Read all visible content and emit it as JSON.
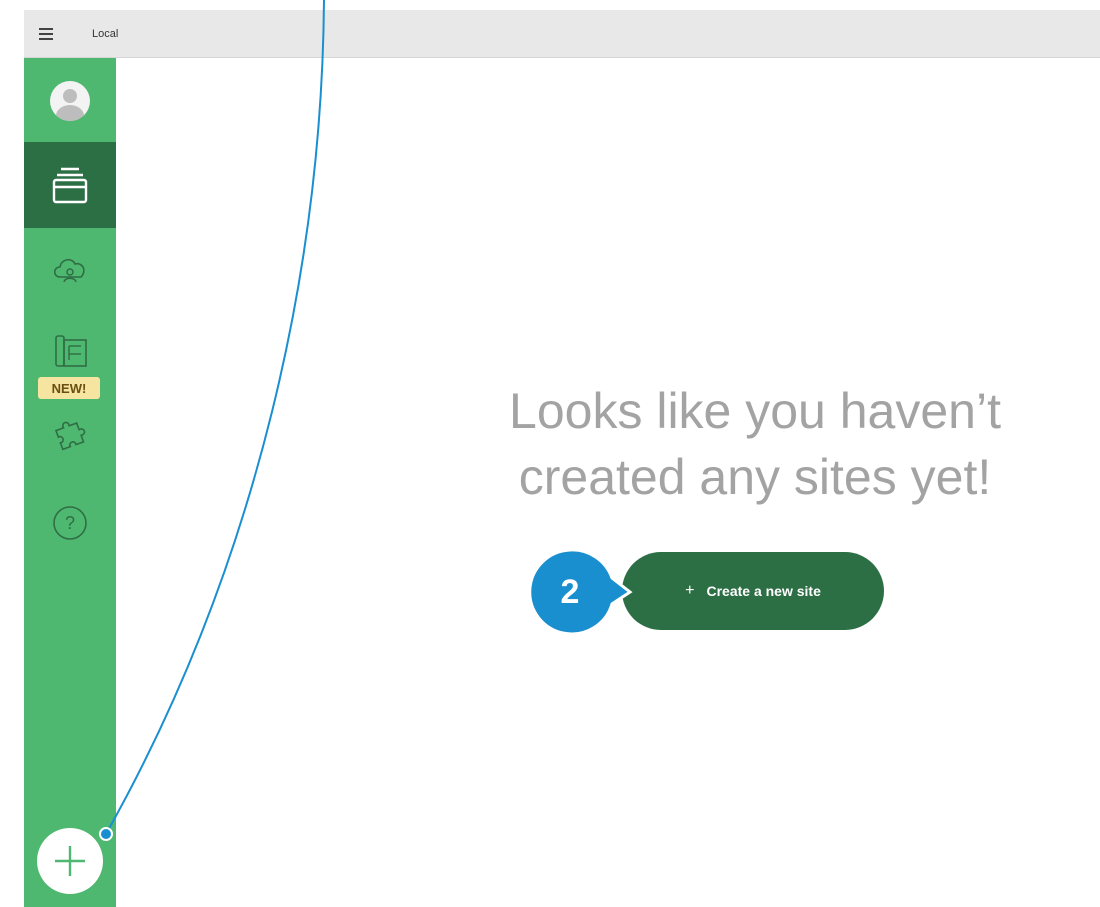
{
  "titlebar": {
    "menu_icon": "hamburger-icon",
    "title": "Local"
  },
  "sidebar": {
    "items": [
      {
        "name": "avatar",
        "icon": "user-avatar-icon"
      },
      {
        "name": "local-sites",
        "icon": "sites-stack-icon",
        "active": true
      },
      {
        "name": "connect",
        "icon": "cloud-connect-icon"
      },
      {
        "name": "blueprints",
        "icon": "blueprint-icon",
        "badge": "NEW!"
      },
      {
        "name": "add-ons",
        "icon": "puzzle-icon"
      },
      {
        "name": "help",
        "icon": "help-circle-icon",
        "label": "?"
      }
    ],
    "add_icon": "plus-icon"
  },
  "main": {
    "empty_line1": "Looks like you haven’t",
    "empty_line2": "created any sites yet!",
    "create_plus": "+",
    "create_label": "Create a new site"
  },
  "callout": {
    "number": "2"
  },
  "colors": {
    "sidebar": "#4fb870",
    "sidebar_active": "#2d6f45",
    "button": "#2d6f45",
    "callout": "#1a8fd0",
    "badge": "#f6e4a1"
  }
}
